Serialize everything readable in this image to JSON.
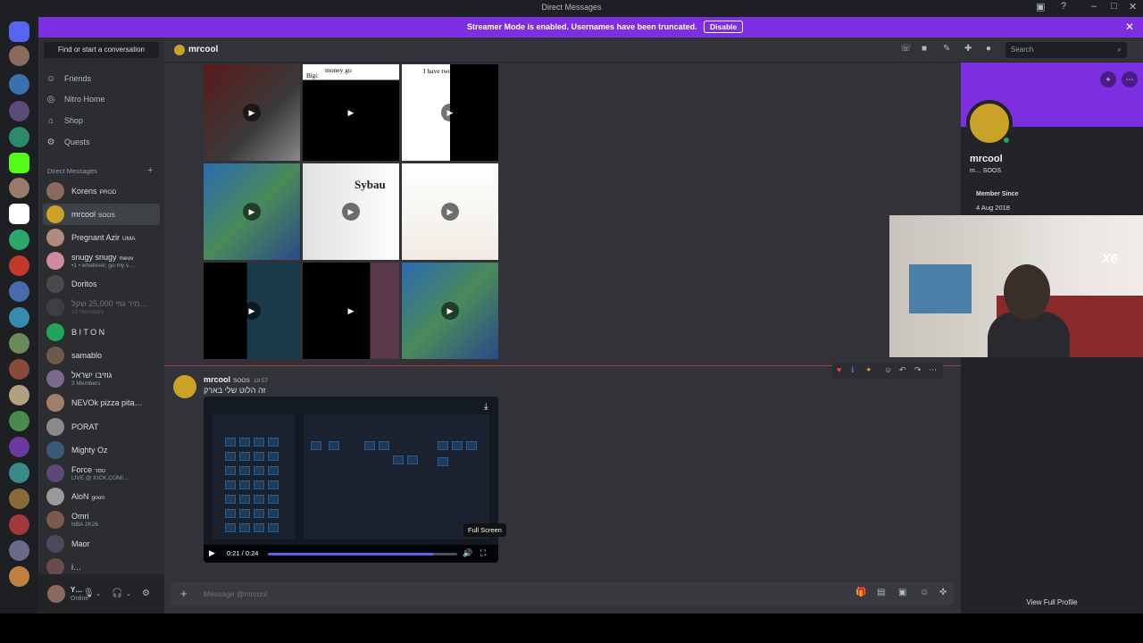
{
  "window": {
    "title": "Direct Messages"
  },
  "streamer_banner": {
    "message": "Streamer Mode is enabled. Usernames have been truncated.",
    "disable_label": "Disable"
  },
  "sidebar": {
    "find_label": "Find or start a conversation",
    "nav": [
      "Friends",
      "Nitro Home",
      "Shop",
      "Quests"
    ],
    "dm_header": "Direct Messages",
    "dms": [
      {
        "name": "Korens",
        "tag": "PROD",
        "sub": ""
      },
      {
        "name": "mrcool",
        "tag": "SOOS",
        "sub": ""
      },
      {
        "name": "Pregnant Azir",
        "tag": "UMA",
        "sub": ""
      },
      {
        "name": "snugy snugy",
        "tag": "meov",
        "sub": "•1 • whatever, go my s…"
      },
      {
        "name": "Doritos",
        "tag": "",
        "sub": ""
      },
      {
        "name": "מיר גוזי 25,000 שקל…",
        "tag": "",
        "sub": "10 Members"
      },
      {
        "name": "B I T O N",
        "tag": "",
        "sub": ""
      },
      {
        "name": "samablo",
        "tag": "",
        "sub": ""
      },
      {
        "name": "גוזיבו ישראל",
        "tag": "",
        "sub": "3 Members"
      },
      {
        "name": "NEVOk pizza pita…",
        "tag": "",
        "sub": ""
      },
      {
        "name": "PORAT",
        "tag": "",
        "sub": ""
      },
      {
        "name": "Mighty Oz",
        "tag": "",
        "sub": ""
      },
      {
        "name": "Force",
        "tag": "טסר",
        "sub": "LIVE @ KICK.COM/…"
      },
      {
        "name": "AloN",
        "tag": "goon",
        "sub": ""
      },
      {
        "name": "Omri",
        "tag": "",
        "sub": "NBA 2K26"
      },
      {
        "name": "Maor",
        "tag": "",
        "sub": ""
      },
      {
        "name": "i…",
        "tag": "",
        "sub": ""
      }
    ],
    "user": {
      "name": "Y…",
      "status": "Online"
    }
  },
  "chat_header": {
    "name": "mrcool",
    "search_placeholder": "Search"
  },
  "media_grid": {
    "captions": [
      "",
      "Bigi:",
      "I have two sides",
      "",
      "Sybau",
      "",
      "",
      "",
      ""
    ],
    "top_caption": "money go"
  },
  "message": {
    "author": "mrcool",
    "tag": "SOOS",
    "time": "19:57",
    "text": "זה הלוט שלי בארק",
    "video": {
      "time": "0:21 / 0:24",
      "progress": 0.875,
      "tooltip": "Full Screen"
    }
  },
  "composer": {
    "placeholder": "Message @mrcool"
  },
  "profile": {
    "name": "mrcool",
    "sub": "m… SOOS",
    "member_since_label": "Member Since",
    "member_since": "4 Aug 2018",
    "view_full": "View Full Profile"
  },
  "webcam": {
    "overlay": "X6"
  },
  "colors": {
    "accent": "#5865f2",
    "banner": "#7b2fe0",
    "online": "#23a559"
  }
}
